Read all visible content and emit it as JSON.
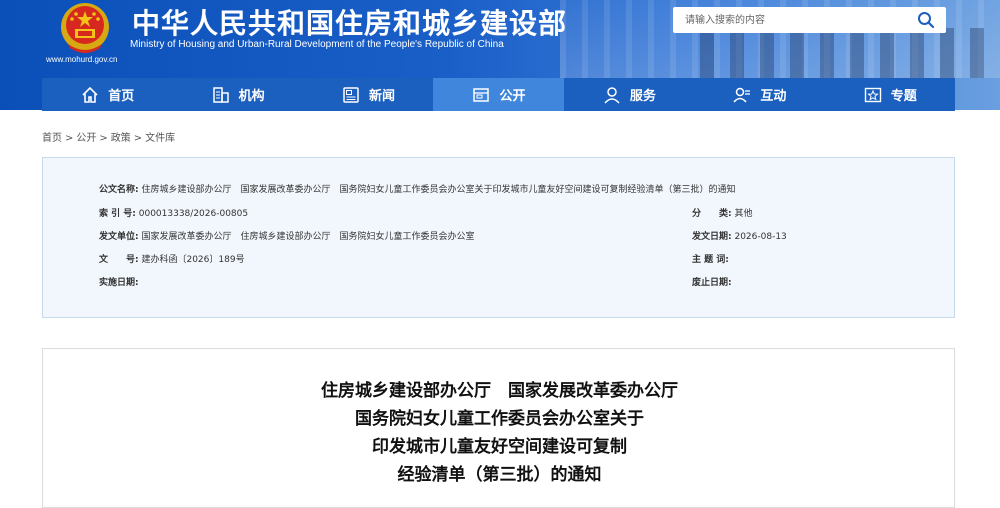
{
  "header": {
    "title": "中华人民共和国住房和城乡建设部",
    "subtitle": "Ministry of Housing and Urban-Rural Development of the People's Republic of China",
    "url": "www.mohurd.gov.cn",
    "search_placeholder": "请输入搜索的内容"
  },
  "nav": {
    "items": [
      {
        "label": "首页",
        "icon": "home-icon"
      },
      {
        "label": "机构",
        "icon": "building-icon"
      },
      {
        "label": "新闻",
        "icon": "news-icon"
      },
      {
        "label": "公开",
        "icon": "folder-icon"
      },
      {
        "label": "服务",
        "icon": "user-service-icon"
      },
      {
        "label": "互动",
        "icon": "interaction-icon"
      },
      {
        "label": "专题",
        "icon": "star-icon"
      }
    ],
    "active_index": 3
  },
  "breadcrumb": [
    "首页",
    "公开",
    "政策",
    "文件库"
  ],
  "breadcrumb_sep": ">",
  "info": {
    "doc_name_label": "公文名称:",
    "doc_name": "住房城乡建设部办公厅　国家发展改革委办公厅　国务院妇女儿童工作委员会办公室关于印发城市儿童友好空间建设可复制经验清单（第三批）的通知",
    "index_label": "索 引 号:",
    "index_value": "000013338/2026-00805",
    "category_label": "分　　类:",
    "category_value": "其他",
    "issuer_label": "发文单位:",
    "issuer_value": "国家发展改革委办公厅　住房城乡建设部办公厅　国务院妇女儿童工作委员会办公室",
    "date_label": "发文日期:",
    "date_value": "2026-08-13",
    "number_label": "文　　号:",
    "number_value": "建办科函〔2026〕189号",
    "subject_label": "主 题 词:",
    "subject_value": "",
    "effective_label": "实施日期:",
    "effective_value": "",
    "expiry_label": "废止日期:",
    "expiry_value": ""
  },
  "document": {
    "title_lines": [
      "住房城乡建设部办公厅　国家发展改革委办公厅",
      "国务院妇女儿童工作委员会办公室关于",
      "印发城市儿童友好空间建设可复制",
      "经验清单（第三批）的通知"
    ]
  },
  "colors": {
    "header_blue": "#0b4fb8",
    "nav_blue": "#1b5fbf",
    "nav_active": "#3f86dc",
    "info_bg": "#f2f7fd",
    "emblem_red": "#d6281e",
    "emblem_gold": "#f3c318"
  }
}
